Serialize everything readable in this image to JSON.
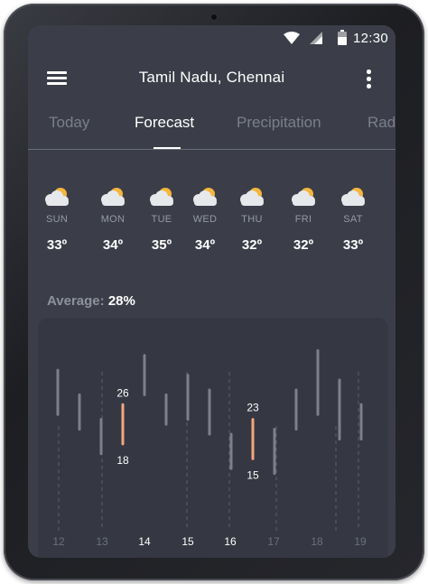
{
  "status": {
    "time": "12:30"
  },
  "appbar": {
    "title": "Tamil Nadu, Chennai"
  },
  "tabs": [
    {
      "label": "Today",
      "active": false
    },
    {
      "label": "Forecast",
      "active": true
    },
    {
      "label": "Precipitation",
      "active": false
    },
    {
      "label": "Rad",
      "active": false
    }
  ],
  "days": [
    {
      "name": "SUN",
      "temp": "33º",
      "icon": "partly-cloudy-icon"
    },
    {
      "name": "MON",
      "temp": "34º",
      "icon": "partly-cloudy-icon"
    },
    {
      "name": "TUE",
      "temp": "35º",
      "icon": "partly-cloudy-icon"
    },
    {
      "name": "WED",
      "temp": "34º",
      "icon": "partly-cloudy-icon"
    },
    {
      "name": "THU",
      "temp": "32º",
      "icon": "partly-cloudy-icon"
    },
    {
      "name": "FRI",
      "temp": "32º",
      "icon": "partly-cloudy-icon"
    },
    {
      "name": "SAT",
      "temp": "33º",
      "icon": "partly-cloudy-icon"
    }
  ],
  "average": {
    "label": "Average:",
    "value": "28%"
  },
  "colors": {
    "screen_bg": "#3b3e48",
    "card_bg": "#353842",
    "bar": "#7d8089",
    "highlight": "#f2a67d"
  },
  "chart_data": {
    "type": "range-bar",
    "x_ticks": [
      "12",
      "13",
      "14",
      "15",
      "16",
      "17",
      "18",
      "19"
    ],
    "highlighted_ticks": [
      "14",
      "15",
      "16"
    ],
    "ylim": [
      0,
      40
    ],
    "ranges": [
      {
        "low": 24,
        "high": 33
      },
      {
        "low": 21,
        "high": 28
      },
      {
        "low": 16,
        "high": 23
      },
      {
        "low": 18,
        "high": 26,
        "highlight": true,
        "low_label": "18",
        "high_label": "26"
      },
      {
        "low": 28,
        "high": 36
      },
      {
        "low": 22,
        "high": 28
      },
      {
        "low": 23,
        "high": 32
      },
      {
        "low": 20,
        "high": 29
      },
      {
        "low": 13,
        "high": 20
      },
      {
        "low": 15,
        "high": 23,
        "highlight": true,
        "low_label": "15",
        "high_label": "23"
      },
      {
        "low": 12,
        "high": 21
      },
      {
        "low": 21,
        "high": 29
      },
      {
        "low": 24,
        "high": 37
      },
      {
        "low": 19,
        "high": 31
      },
      {
        "low": 19,
        "high": 26
      }
    ]
  }
}
